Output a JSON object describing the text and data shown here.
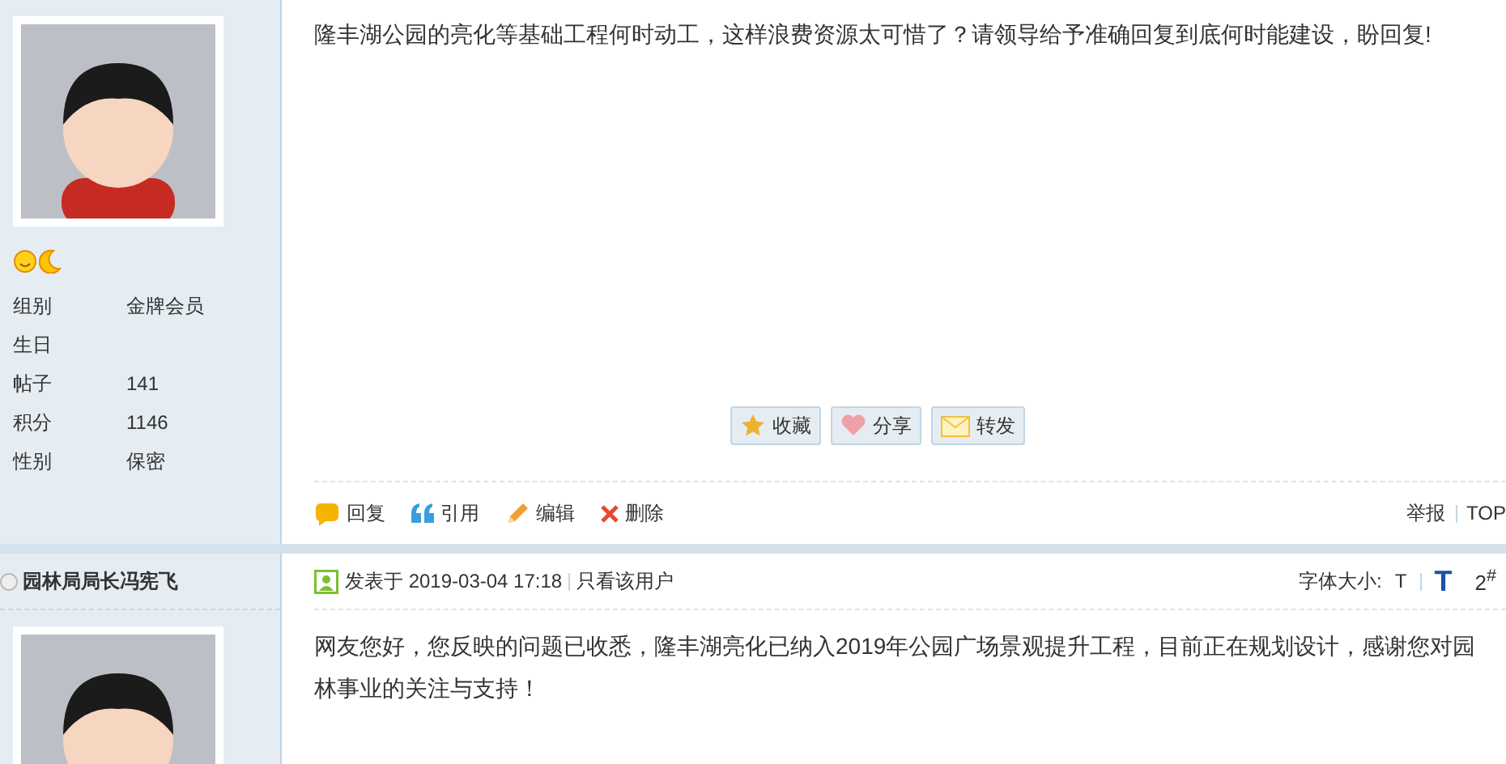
{
  "post_1": {
    "profile": [
      {
        "label": "组别",
        "value": "金牌会员"
      },
      {
        "label": "生日"
      },
      {
        "label": "帖子",
        "value": "141"
      },
      {
        "label": "积分",
        "value": "1146"
      },
      {
        "label": "性别",
        "value": "保密"
      }
    ],
    "message": "隆丰湖公园的亮化等基础工程何时动工，这样浪费资源太可惜了？请领导给予准确回复到底何时能建设，盼回复!",
    "share_buttons": [
      {
        "kind": "star",
        "label": "收藏"
      },
      {
        "kind": "heart",
        "label": "分享"
      },
      {
        "kind": "mail",
        "label": "转发"
      }
    ],
    "actions": [
      {
        "kind": "reply",
        "label": "回复"
      },
      {
        "kind": "quote",
        "label": "引用"
      },
      {
        "kind": "edit",
        "label": "编辑"
      },
      {
        "kind": "delete",
        "label": "删除"
      }
    ],
    "links": [
      "举报",
      "TOP"
    ]
  },
  "post_2": {
    "author": "园林局局长冯宪飞",
    "posted": "发表于 2019-03-04 17:18",
    "only_author": "只看该用户",
    "font_size_label": "字体大小:",
    "font_small": "T",
    "font_large": "T",
    "floor": "2$^{#}$",
    "message": "网友您好，您反映的问题已收悉，隆丰湖亮化已纳入2019年公园广场景观提升工程，目前正在规划设计，感谢您对园林事业的关注与支持！"
  }
}
